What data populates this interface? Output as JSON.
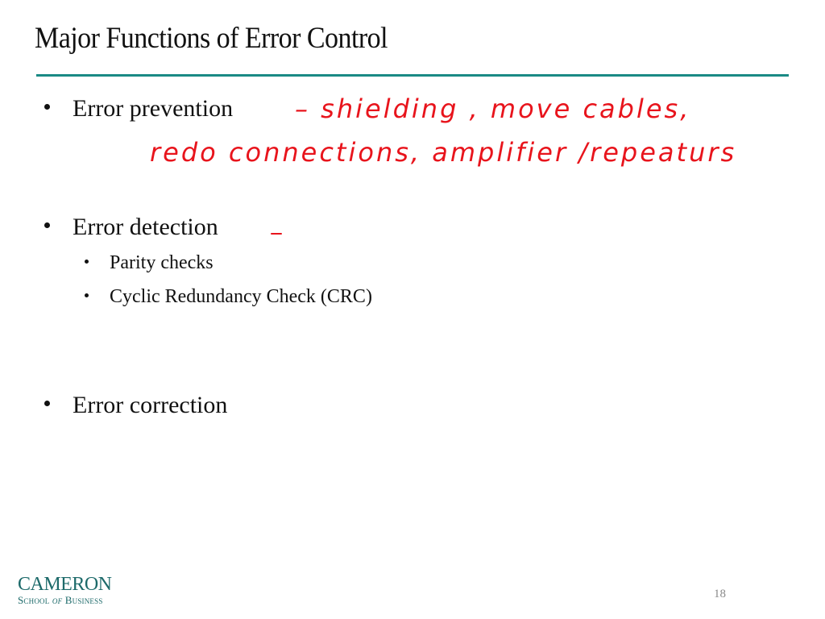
{
  "slide": {
    "title": "Major Functions of Error Control",
    "accent_color": "#1a8a85",
    "ink_color": "#e8141c",
    "bullets": [
      {
        "label": "Error prevention",
        "annotation_line1": "– shielding , move cables,",
        "annotation_line2": "redo connections, amplifier /repeaturs"
      },
      {
        "label": "Error detection",
        "annotation": "–",
        "sub_bullets": [
          "Parity checks",
          "Cyclic Redundancy Check (CRC)"
        ]
      },
      {
        "label": "Error correction"
      }
    ],
    "page_number": "18"
  },
  "logo": {
    "name": "CAMERON",
    "subtitle_prefix": "School",
    "subtitle_of": "of",
    "subtitle_suffix": "Business"
  }
}
